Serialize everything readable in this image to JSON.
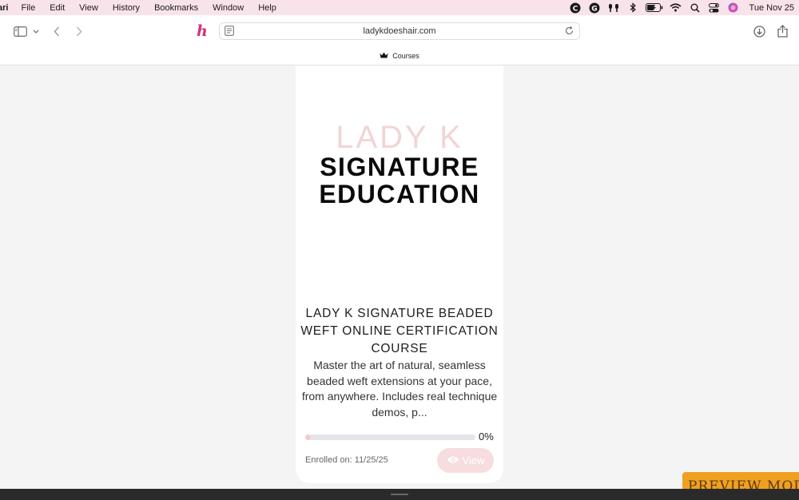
{
  "menubar": {
    "app_name": "ari",
    "items": [
      "File",
      "Edit",
      "View",
      "History",
      "Bookmarks",
      "Window",
      "Help"
    ],
    "clock": "Tue Nov 25"
  },
  "toolbar": {
    "url": "ladykdoeshair.com",
    "extension_logo": "h"
  },
  "tab": {
    "title": "Courses"
  },
  "card": {
    "brand": "LADY K",
    "hero_title_line1": "SIGNATURE",
    "hero_title_line2": "EDUCATION",
    "course_title": "LADY K SIGNATURE BEADED WEFT ONLINE CERTIFICATION COURSE",
    "course_description": "Master the art of natural, seamless beaded weft extensions at your pace, from anywhere. Includes real technique demos, p...",
    "progress_percent": 0,
    "progress_label": "0%",
    "enrolled_label": "Enrolled on: 11/25/25",
    "view_button_label": "View"
  },
  "preview_badge": "PREVIEW MODE",
  "colors": {
    "menubar_bg": "#f9e3ea",
    "brand_pink": "#f2d4d6",
    "accent_magenta": "#d4317a",
    "preview_orange": "#f0a020"
  }
}
